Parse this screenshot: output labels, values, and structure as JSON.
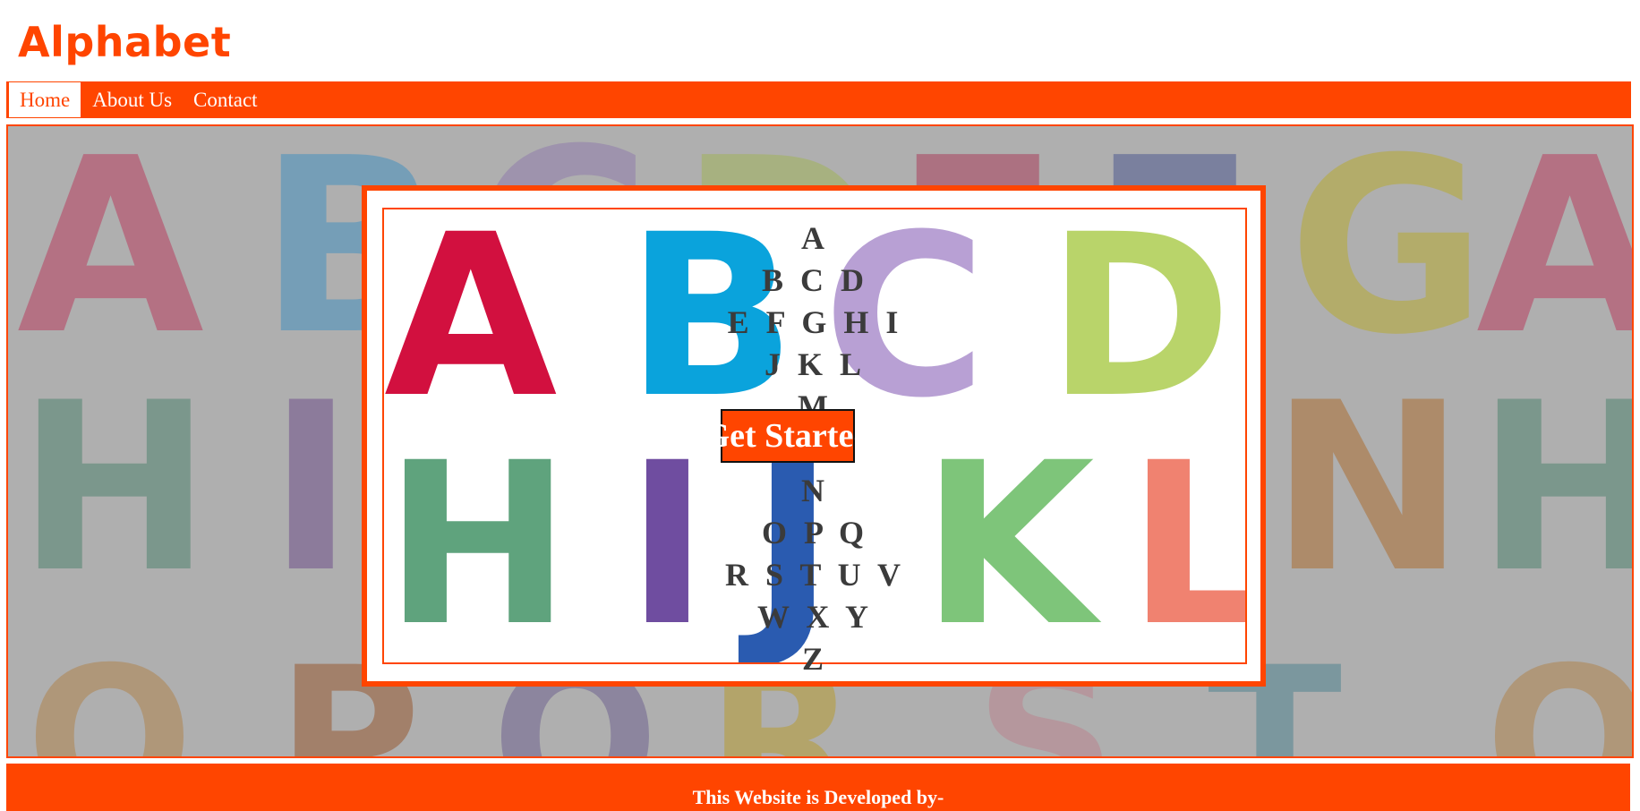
{
  "site": {
    "title": "Alphabet"
  },
  "nav": {
    "items": [
      {
        "label": "Home",
        "active": true
      },
      {
        "label": "About Us",
        "active": false
      },
      {
        "label": "Contact",
        "active": false
      }
    ]
  },
  "hero": {
    "alphabet_rows": [
      "A",
      "B C D",
      "E F G H I",
      "J K L",
      "M",
      "N",
      "O P Q",
      "R S T U V",
      "W X Y",
      "Z"
    ],
    "cta_label": "Get Started"
  },
  "footer": {
    "text": "This Website is Developed by-"
  },
  "colors": {
    "accent": "#ff4500",
    "text_dark": "#3b3b3b",
    "white": "#ffffff"
  }
}
